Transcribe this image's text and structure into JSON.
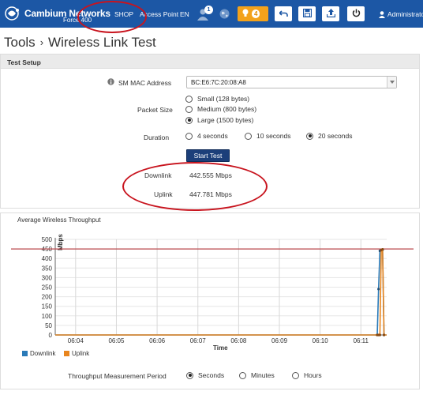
{
  "header": {
    "brand_name": "Cambium Networks",
    "model": "Force 400",
    "nav": [
      "SHOP",
      "Access Point",
      "EN"
    ],
    "user_badge": "1",
    "alert_count": "4",
    "admin_label": "Administrator",
    "colors": {
      "bar": "#1c57a5",
      "alert": "#f3a21b"
    },
    "icons": [
      "user-icon",
      "globe-icon",
      "lightbulb-icon",
      "undo-icon",
      "save-icon",
      "upload-icon",
      "power-icon",
      "person-icon"
    ]
  },
  "page": {
    "section": "Tools",
    "title": "Wireless Link Test",
    "separator": "›"
  },
  "setup": {
    "heading": "Test Setup",
    "mac_label": "SM MAC Address",
    "mac_value": "BC:E6:7C:20:08:A8",
    "packet_label": "Packet Size",
    "packet_options": [
      "Small (128 bytes)",
      "Medium (800 bytes)",
      "Large (1500 bytes)"
    ],
    "packet_selected": "Large (1500 bytes)",
    "duration_label": "Duration",
    "duration_options": [
      "4 seconds",
      "10 seconds",
      "20 seconds"
    ],
    "duration_selected": "20 seconds",
    "start_label": "Start Test",
    "downlink_label": "Downlink",
    "downlink_value": "442.555 Mbps",
    "uplink_label": "Uplink",
    "uplink_value": "447.781 Mbps"
  },
  "chart_section": {
    "title": "Average Wireless Throughput",
    "period_label": "Throughput Measurement Period",
    "period_options": [
      "Seconds",
      "Minutes",
      "Hours"
    ],
    "period_selected": "Seconds"
  },
  "chart_data": {
    "type": "line",
    "title": "Average Wireless Throughput",
    "xlabel": "Time",
    "ylabel": "Mbps",
    "ylim": [
      0,
      500
    ],
    "yticks": [
      0,
      50,
      100,
      150,
      200,
      250,
      300,
      350,
      400,
      450,
      500
    ],
    "xticks": [
      "06:04",
      "06:05",
      "06:06",
      "06:07",
      "06:08",
      "06:09",
      "06:10",
      "06:11"
    ],
    "x": [
      "06:03:30",
      "06:11:24",
      "06:11:26",
      "06:11:28",
      "06:11:30",
      "06:11:32",
      "06:11:34",
      "06:11:38"
    ],
    "series": [
      {
        "name": "Downlink",
        "color": "#2a7ab8",
        "values": [
          0,
          0,
          240,
          440,
          442,
          446,
          0,
          0
        ]
      },
      {
        "name": "Uplink",
        "color": "#e8851e",
        "values": [
          0,
          0,
          0,
          0,
          445,
          448,
          0,
          0
        ]
      }
    ],
    "reference_line": {
      "value": 450,
      "color": "#b8464a"
    },
    "legend_position": "bottom-left",
    "grid": true
  },
  "annotations": {
    "highlight_color": "#c8141e"
  }
}
